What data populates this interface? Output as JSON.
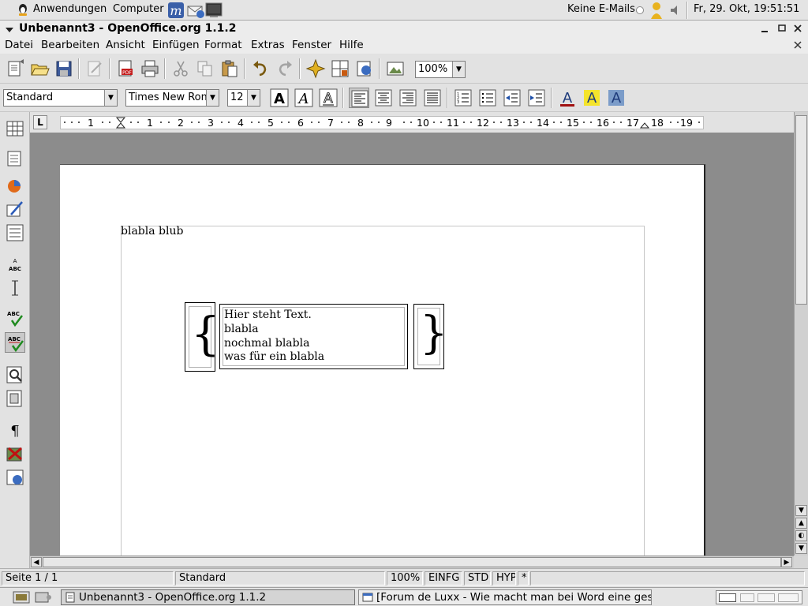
{
  "panel": {
    "apps_label": "Anwendungen",
    "computer_label": "Computer",
    "mail_status": "Keine E-Mails.",
    "clock": "Fr, 29. Okt, 19:51:51"
  },
  "window": {
    "title": "Unbenannt3 - OpenOffice.org 1.1.2"
  },
  "menu": {
    "items": [
      "Datei",
      "Bearbeiten",
      "Ansicht",
      "Einfügen",
      "Format",
      "Extras",
      "Fenster",
      "Hilfe"
    ]
  },
  "toolbar": {
    "zoom": "100%"
  },
  "formatting": {
    "paragraph_style": "Standard",
    "font_name": "Times New Roman",
    "font_size": "12"
  },
  "ruler": {
    "numbers": [
      "1",
      "1",
      "2",
      "3",
      "4",
      "5",
      "6",
      "7",
      "8",
      "9",
      "10",
      "11",
      "12",
      "13",
      "14",
      "15",
      "16",
      "17",
      "18",
      "19"
    ]
  },
  "document": {
    "first_line": "blabla blub",
    "left_brace": "{",
    "right_brace": "}",
    "text_lines": [
      "Hier steht Text.",
      "blabla",
      "nochmal blabla",
      "was für ein blabla"
    ]
  },
  "status": {
    "page": "Seite 1 / 1",
    "style": "Standard",
    "zoom": "100%",
    "insert_mode": "EINFG",
    "selection_mode": "STD",
    "hyperlink_mode": "HYP",
    "modified": "*"
  },
  "taskbar": {
    "tasks": [
      "Unbenannt3 - OpenOffice.org 1.1.2",
      "[Forum de Luxx - Wie macht man bei Word eine geschw"
    ]
  }
}
